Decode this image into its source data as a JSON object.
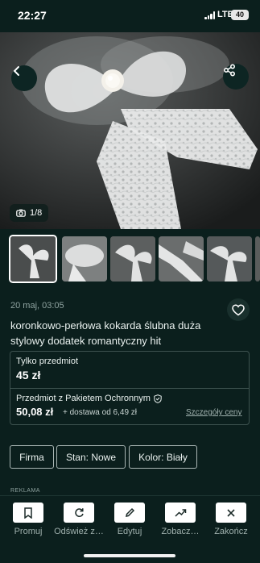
{
  "status_bar": {
    "time": "22:27",
    "network": "LTE",
    "battery": "40"
  },
  "gallery": {
    "counter": "1/8",
    "thumbnails": [
      "lace-bow-1",
      "lace-bow-2",
      "lace-bow-3",
      "lace-bow-4",
      "lace-bow-5",
      "lace-bow-6"
    ]
  },
  "listing": {
    "date": "20 maj, 03:05",
    "title": "koronkowo-perłowa kokarda ślubna duża stylowy dodatek romantyczny hit"
  },
  "price": {
    "only_label": "Tylko przedmiot",
    "only_price": "45 zł",
    "protect_label": "Przedmiot z Pakietem Ochronnym",
    "protect_price": "50,08 zł",
    "delivery": "+ dostawa od 6,49 zł",
    "details_link": "Szczegóły ceny"
  },
  "chips": [
    "Firma",
    "Stan: Nowe",
    "Kolor: Biały"
  ],
  "ad_label": "REKLAMA",
  "actions": [
    {
      "label": "Promuj",
      "icon": "bookmark-icon"
    },
    {
      "label": "Odśwież z…",
      "icon": "refresh-icon"
    },
    {
      "label": "Edytuj",
      "icon": "pencil-icon"
    },
    {
      "label": "Zobacz…",
      "icon": "trend-up-icon"
    },
    {
      "label": "Zakończ",
      "icon": "close-icon"
    }
  ],
  "colors": {
    "background": "#0b1f1d",
    "border": "#3d524f",
    "text": "#eaf1ef"
  }
}
